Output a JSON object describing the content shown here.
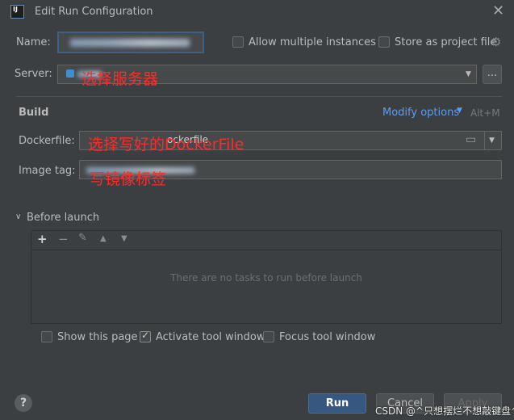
{
  "window": {
    "title": "Edit Run Configuration",
    "app_icon_text": "IJ"
  },
  "name_row": {
    "label": "Name:",
    "allow_multiple_label": "Allow multiple instances",
    "store_project_label": "Store as project file"
  },
  "server_row": {
    "label": "Server:",
    "annotation": "选择服务器",
    "more_button": "..."
  },
  "build": {
    "heading": "Build",
    "modify_options": "Modify options",
    "modify_shortcut": "Alt+M",
    "dockerfile_label": "Dockerfile:",
    "dockerfile_value": "ockerfile",
    "dockerfile_annotation": "选择写好的DockerFile",
    "image_tag_label": "Image tag:",
    "image_tag_value": "",
    "image_tag_annotation": "写镜像标签"
  },
  "before_launch": {
    "heading": "Before launch",
    "empty_text": "There are no tasks to run before launch",
    "toolbar": {
      "add": "+",
      "remove": "−",
      "edit": "✎",
      "up": "▲",
      "down": "▼"
    }
  },
  "options": {
    "show_page": "Show this page",
    "show_page_checked": false,
    "activate_tool": "Activate tool window",
    "activate_tool_checked": true,
    "focus_tool": "Focus tool window",
    "focus_tool_checked": false
  },
  "footer": {
    "help": "?",
    "run": "Run",
    "cancel": "Cancel",
    "apply": "Apply",
    "watermark": "CSDN @^只想摆烂不想敲键盘^"
  }
}
